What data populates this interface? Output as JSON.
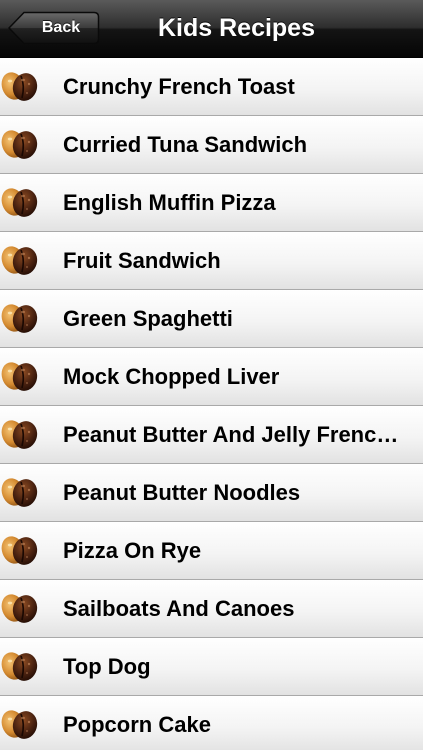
{
  "navbar": {
    "back_label": "Back",
    "title": "Kids Recipes"
  },
  "recipes": [
    {
      "label": "Crunchy French Toast",
      "icon": "cookie-icon"
    },
    {
      "label": "Curried Tuna Sandwich",
      "icon": "cookie-icon"
    },
    {
      "label": "English Muffin Pizza",
      "icon": "cookie-icon"
    },
    {
      "label": "Fruit Sandwich",
      "icon": "cookie-icon"
    },
    {
      "label": "Green Spaghetti",
      "icon": "cookie-icon"
    },
    {
      "label": "Mock Chopped Liver",
      "icon": "cookie-icon"
    },
    {
      "label": "Peanut Butter And Jelly French Toast",
      "icon": "cookie-icon"
    },
    {
      "label": "Peanut Butter Noodles",
      "icon": "cookie-icon"
    },
    {
      "label": "Pizza On Rye",
      "icon": "cookie-icon"
    },
    {
      "label": "Sailboats And Canoes",
      "icon": "cookie-icon"
    },
    {
      "label": "Top Dog",
      "icon": "cookie-icon"
    },
    {
      "label": "Popcorn Cake",
      "icon": "cookie-icon"
    }
  ],
  "colors": {
    "navbar": "#1c1c1c",
    "cookie_dark": "#3b1a0c",
    "cookie_light": "#c8822c",
    "row_separator": "#a9a9a9"
  }
}
